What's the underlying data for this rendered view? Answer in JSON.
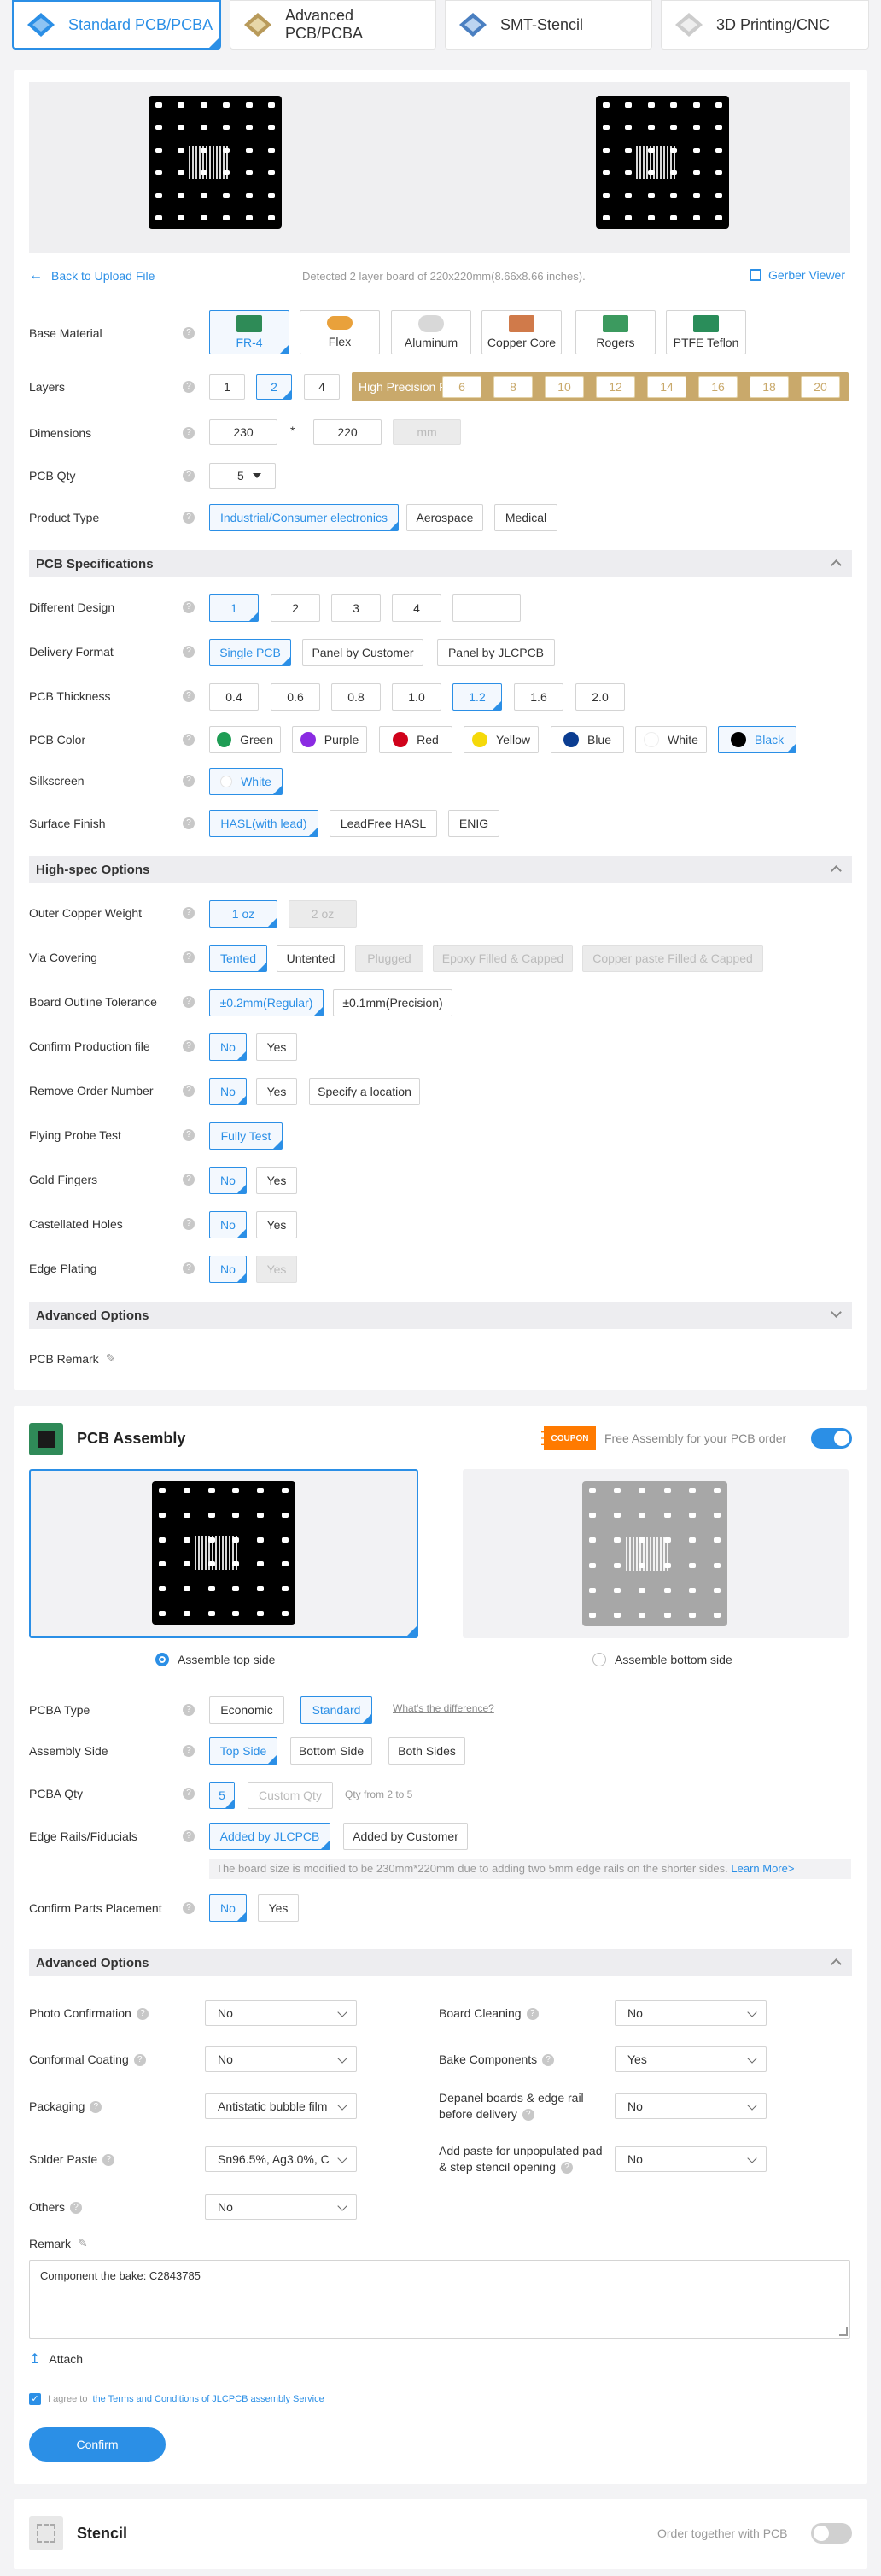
{
  "tabs": [
    {
      "label": "Standard PCB/PCBA",
      "active": true
    },
    {
      "label": "Advanced PCB/PCBA",
      "active": false
    },
    {
      "label": "SMT-Stencil",
      "active": false
    },
    {
      "label": "3D Printing/CNC",
      "active": false
    }
  ],
  "upload": {
    "back_label": "Back to Upload File",
    "detected_text": "Detected 2 layer board of 220x220mm(8.66x8.66 inches).",
    "gerber_label": "Gerber Viewer"
  },
  "pcb": {
    "base_material": {
      "label": "Base Material",
      "options": [
        "FR-4",
        "Flex",
        "Aluminum",
        "Copper Core",
        "Rogers",
        "PTFE Teflon"
      ],
      "selected": "FR-4"
    },
    "layers": {
      "label": "Layers",
      "options": [
        "1",
        "2",
        "4"
      ],
      "selected": "2",
      "hp_label": "High Precision PCB",
      "hp_options": [
        "6",
        "8",
        "10",
        "12",
        "14",
        "16",
        "18",
        "20"
      ]
    },
    "dimensions": {
      "label": "Dimensions",
      "width": "230",
      "height": "220",
      "sep": "*",
      "unit": "mm"
    },
    "qty": {
      "label": "PCB Qty",
      "value": "5"
    },
    "product_type": {
      "label": "Product Type",
      "options": [
        "Industrial/Consumer electronics",
        "Aerospace",
        "Medical"
      ],
      "selected": "Industrial/Consumer electronics"
    },
    "spec_title": "PCB Specifications",
    "different_design": {
      "label": "Different Design",
      "options": [
        "1",
        "2",
        "3",
        "4",
        ""
      ],
      "selected": "1"
    },
    "delivery_format": {
      "label": "Delivery Format",
      "options": [
        "Single PCB",
        "Panel by Customer",
        "Panel by JLCPCB"
      ],
      "selected": "Single PCB"
    },
    "thickness": {
      "label": "PCB Thickness",
      "options": [
        "0.4",
        "0.6",
        "0.8",
        "1.0",
        "1.2",
        "1.6",
        "2.0"
      ],
      "selected": "1.2"
    },
    "color": {
      "label": "PCB Color",
      "options": [
        {
          "name": "Green",
          "hex": "#1f9d55"
        },
        {
          "name": "Purple",
          "hex": "#8a2be2"
        },
        {
          "name": "Red",
          "hex": "#d0021b"
        },
        {
          "name": "Yellow",
          "hex": "#f5d90a"
        },
        {
          "name": "Blue",
          "hex": "#0b3d91"
        },
        {
          "name": "White",
          "hex": "#ffffff"
        },
        {
          "name": "Black",
          "hex": "#000000"
        }
      ],
      "selected": "Black"
    },
    "silkscreen": {
      "label": "Silkscreen",
      "value": "White"
    },
    "surface_finish": {
      "label": "Surface Finish",
      "options": [
        "HASL(with lead)",
        "LeadFree HASL",
        "ENIG"
      ],
      "selected": "HASL(with lead)"
    },
    "highspec_title": "High-spec Options",
    "outer_copper": {
      "label": "Outer Copper Weight",
      "options": [
        "1 oz",
        "2 oz"
      ],
      "selected": "1 oz"
    },
    "via_covering": {
      "label": "Via Covering",
      "options": [
        "Tented",
        "Untented",
        "Plugged",
        "Epoxy Filled & Capped",
        "Copper paste Filled & Capped"
      ],
      "selected": "Tented"
    },
    "outline_tolerance": {
      "label": "Board Outline Tolerance",
      "options": [
        "±0.2mm(Regular)",
        "±0.1mm(Precision)"
      ],
      "selected": "±0.2mm(Regular)"
    },
    "confirm_production": {
      "label": "Confirm Production file",
      "options": [
        "No",
        "Yes"
      ],
      "selected": "No"
    },
    "remove_order": {
      "label": "Remove Order Number",
      "options": [
        "No",
        "Yes",
        "Specify a location"
      ],
      "selected": "No"
    },
    "flying_probe": {
      "label": "Flying Probe Test",
      "options": [
        "Fully Test"
      ],
      "selected": "Fully Test"
    },
    "gold_fingers": {
      "label": "Gold Fingers",
      "options": [
        "No",
        "Yes"
      ],
      "selected": "No"
    },
    "castellated": {
      "label": "Castellated Holes",
      "options": [
        "No",
        "Yes"
      ],
      "selected": "No"
    },
    "edge_plating": {
      "label": "Edge Plating",
      "options": [
        "No",
        "Yes"
      ],
      "selected": "No"
    },
    "advanced_title": "Advanced Options",
    "remark_label": "PCB Remark"
  },
  "assembly": {
    "title": "PCB Assembly",
    "coupon": "COUPON",
    "free_text": "Free Assembly for your PCB order",
    "top_label": "Assemble top side",
    "bottom_label": "Assemble bottom side",
    "pcba_type": {
      "label": "PCBA Type",
      "options": [
        "Economic",
        "Standard"
      ],
      "selected": "Standard",
      "link": "What's the difference?"
    },
    "assembly_side": {
      "label": "Assembly Side",
      "options": [
        "Top Side",
        "Bottom Side",
        "Both Sides"
      ],
      "selected": "Top Side"
    },
    "pcba_qty": {
      "label": "PCBA Qty",
      "value": "5",
      "placeholder": "Custom Qty",
      "hint": "Qty from 2 to 5"
    },
    "edge_rails": {
      "label": "Edge Rails/Fiducials",
      "options": [
        "Added by JLCPCB",
        "Added by Customer"
      ],
      "selected": "Added by JLCPCB",
      "note": "The board size is modified to be 230mm*220mm due to adding two 5mm edge rails on the shorter sides.",
      "learn": "Learn More>"
    },
    "confirm_parts": {
      "label": "Confirm Parts Placement",
      "options": [
        "No",
        "Yes"
      ],
      "selected": "No"
    },
    "advanced_title": "Advanced Options",
    "adv_fields": [
      {
        "label": "Photo Confirmation",
        "value": "No"
      },
      {
        "label": "Board Cleaning",
        "value": "No"
      },
      {
        "label": "Conformal Coating",
        "value": "No"
      },
      {
        "label": "Bake Components",
        "value": "Yes"
      },
      {
        "label": "Packaging",
        "value": "Antistatic bubble film"
      },
      {
        "label": "Depanel boards & edge rail",
        "label2": "before delivery",
        "value": "No"
      },
      {
        "label": "Solder Paste",
        "value": "Sn96.5%, Ag3.0%, C"
      },
      {
        "label": "Add paste for unpopulated pad",
        "label2": "& step stencil opening",
        "value": "No"
      },
      {
        "label": "Others",
        "value": "No"
      }
    ],
    "remark_label": "Remark",
    "remark_text": "Component the bake: C2843785",
    "attach_label": "Attach",
    "agree_text": "I agree to",
    "terms_link": "the Terms and Conditions of JLCPCB assembly Service",
    "confirm_label": "Confirm"
  },
  "stencil": {
    "title": "Stencil",
    "order_label": "Order together with PCB"
  },
  "colors": {
    "accent": "#2b8fe6",
    "hp_gold": "#c9a96b",
    "coupon": "#ff7a00"
  }
}
